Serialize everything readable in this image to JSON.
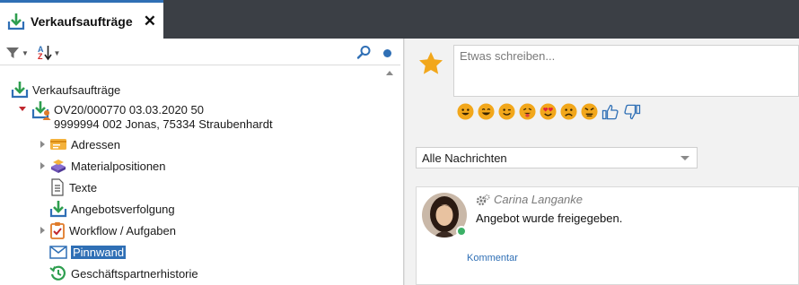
{
  "tab": {
    "title": "Verkaufsaufträge",
    "close": "✕"
  },
  "tree": {
    "root_label": "Verkaufsaufträge",
    "order_line1": "OV20/000770 03.03.2020 50",
    "order_line2": "9999994 002 Jonas, 75334 Straubenhardt",
    "children": [
      {
        "label": "Adressen"
      },
      {
        "label": "Materialpositionen"
      },
      {
        "label": "Texte"
      },
      {
        "label": "Angebotsverfolgung"
      },
      {
        "label": "Workflow / Aufgaben"
      },
      {
        "label": "Pinnwand"
      },
      {
        "label": "Geschäftspartnerhistorie"
      }
    ]
  },
  "board": {
    "compose_placeholder": "Etwas schreiben...",
    "filter_value": "Alle Nachrichten",
    "post": {
      "author": "Carina Langanke",
      "text": "Angebot wurde freigegeben.",
      "comment_label": "Kommentar"
    }
  },
  "colors": {
    "accent": "#2f6fb5",
    "topbar": "#3b3f45",
    "green": "#2e9e4f",
    "emoji": "#f2a71b"
  }
}
